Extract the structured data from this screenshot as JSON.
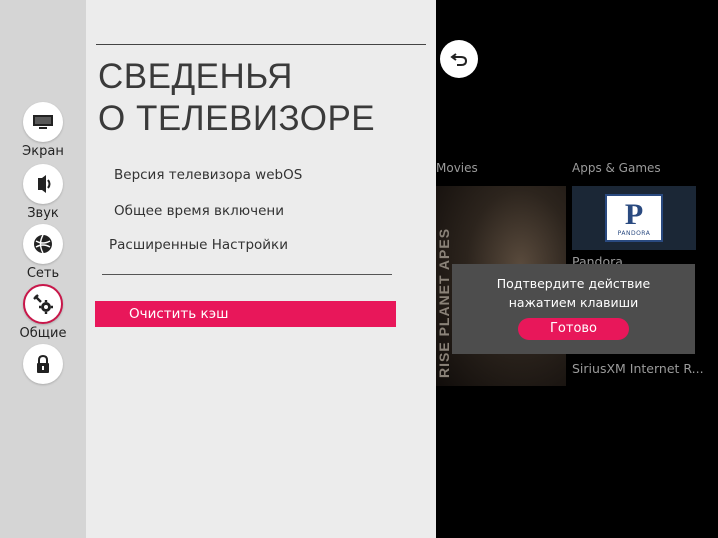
{
  "sidebar": {
    "items": [
      {
        "label": "Экран",
        "icon": "screen-icon"
      },
      {
        "label": "Звук",
        "icon": "sound-icon"
      },
      {
        "label": "Сеть",
        "icon": "network-icon"
      },
      {
        "label": "Общие",
        "icon": "general-settings-icon"
      },
      {
        "label": "",
        "icon": "lock-icon"
      }
    ],
    "selected_index": 3
  },
  "panel": {
    "title_line1": "СВЕДЕНЬЯ",
    "title_line2": "О ТЕЛЕВИЗОРЕ",
    "items": [
      "Версия телевизора  webOS",
      "Общее время включени",
      "Расширенные Настройки"
    ],
    "clear_cache_label": "Очистить кэш"
  },
  "content": {
    "movies_label": "Movies",
    "apps_label": "Apps & Games",
    "poster_text": "RISE PLANET APES",
    "pandora_logo_letter": "P",
    "pandora_logo_word": "PANDORA",
    "app_names": [
      "Pandora",
      "SiriusXM Internet R..."
    ]
  },
  "popup": {
    "line1": "Подтвердите действие",
    "line2": "нажатием клавиши",
    "button_label": "Готово"
  },
  "colors": {
    "accent": "#e8175a",
    "panel_bg": "#ececec",
    "rail_bg": "#d5d5d5",
    "popup_bg": "#4d4d4d"
  }
}
